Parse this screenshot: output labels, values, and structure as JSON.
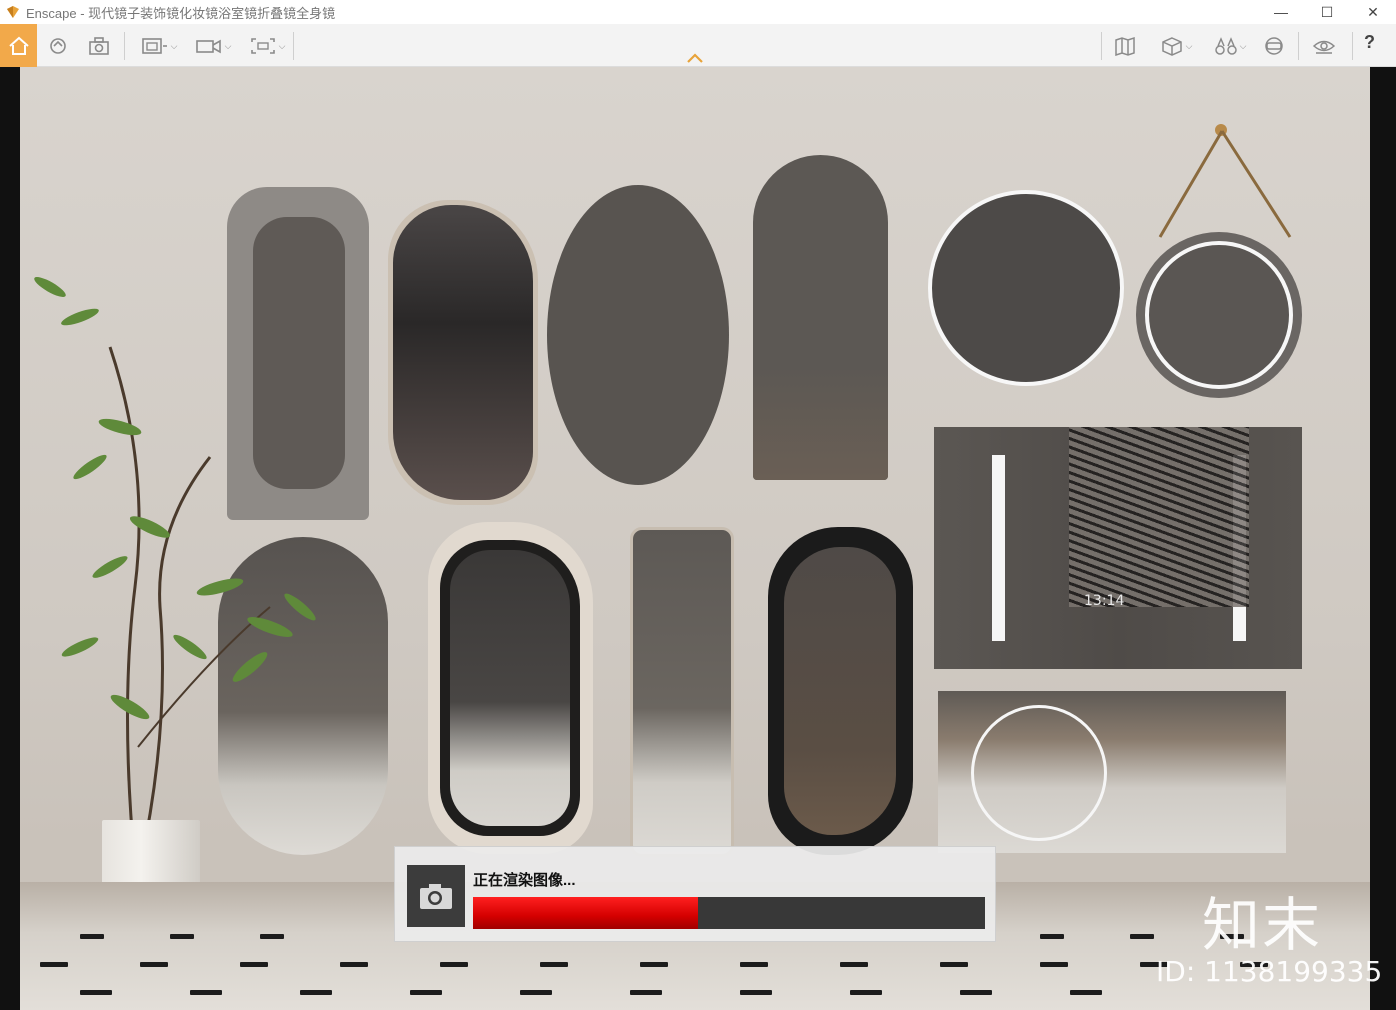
{
  "window": {
    "app_name": "Enscape",
    "separator": " - ",
    "document_title": "现代镜子装饰镜化妆镜浴室镜折叠镜全身镜",
    "minimize_glyph": "—",
    "maximize_glyph": "☐",
    "close_glyph": "✕"
  },
  "toolbar": {
    "help_label": "?",
    "icons": [
      "home-icon",
      "orbit-icon",
      "screenshot-icon",
      "batch-render-icon",
      "video-icon",
      "panorama-icon",
      "map-icon",
      "cube-icon",
      "binoculars-icon",
      "vr-headset-icon",
      "visibility-icon"
    ]
  },
  "render": {
    "status_text": "正在渲染图像...",
    "progress": 0.44,
    "progress_color": "#e60000"
  },
  "scene": {
    "clock_text": "13:14",
    "watermark_logo": "知末",
    "watermark_id": "ID: 1138199335",
    "colors": {
      "wall": "#d5cfc8",
      "accent": "#f2a94a"
    }
  }
}
